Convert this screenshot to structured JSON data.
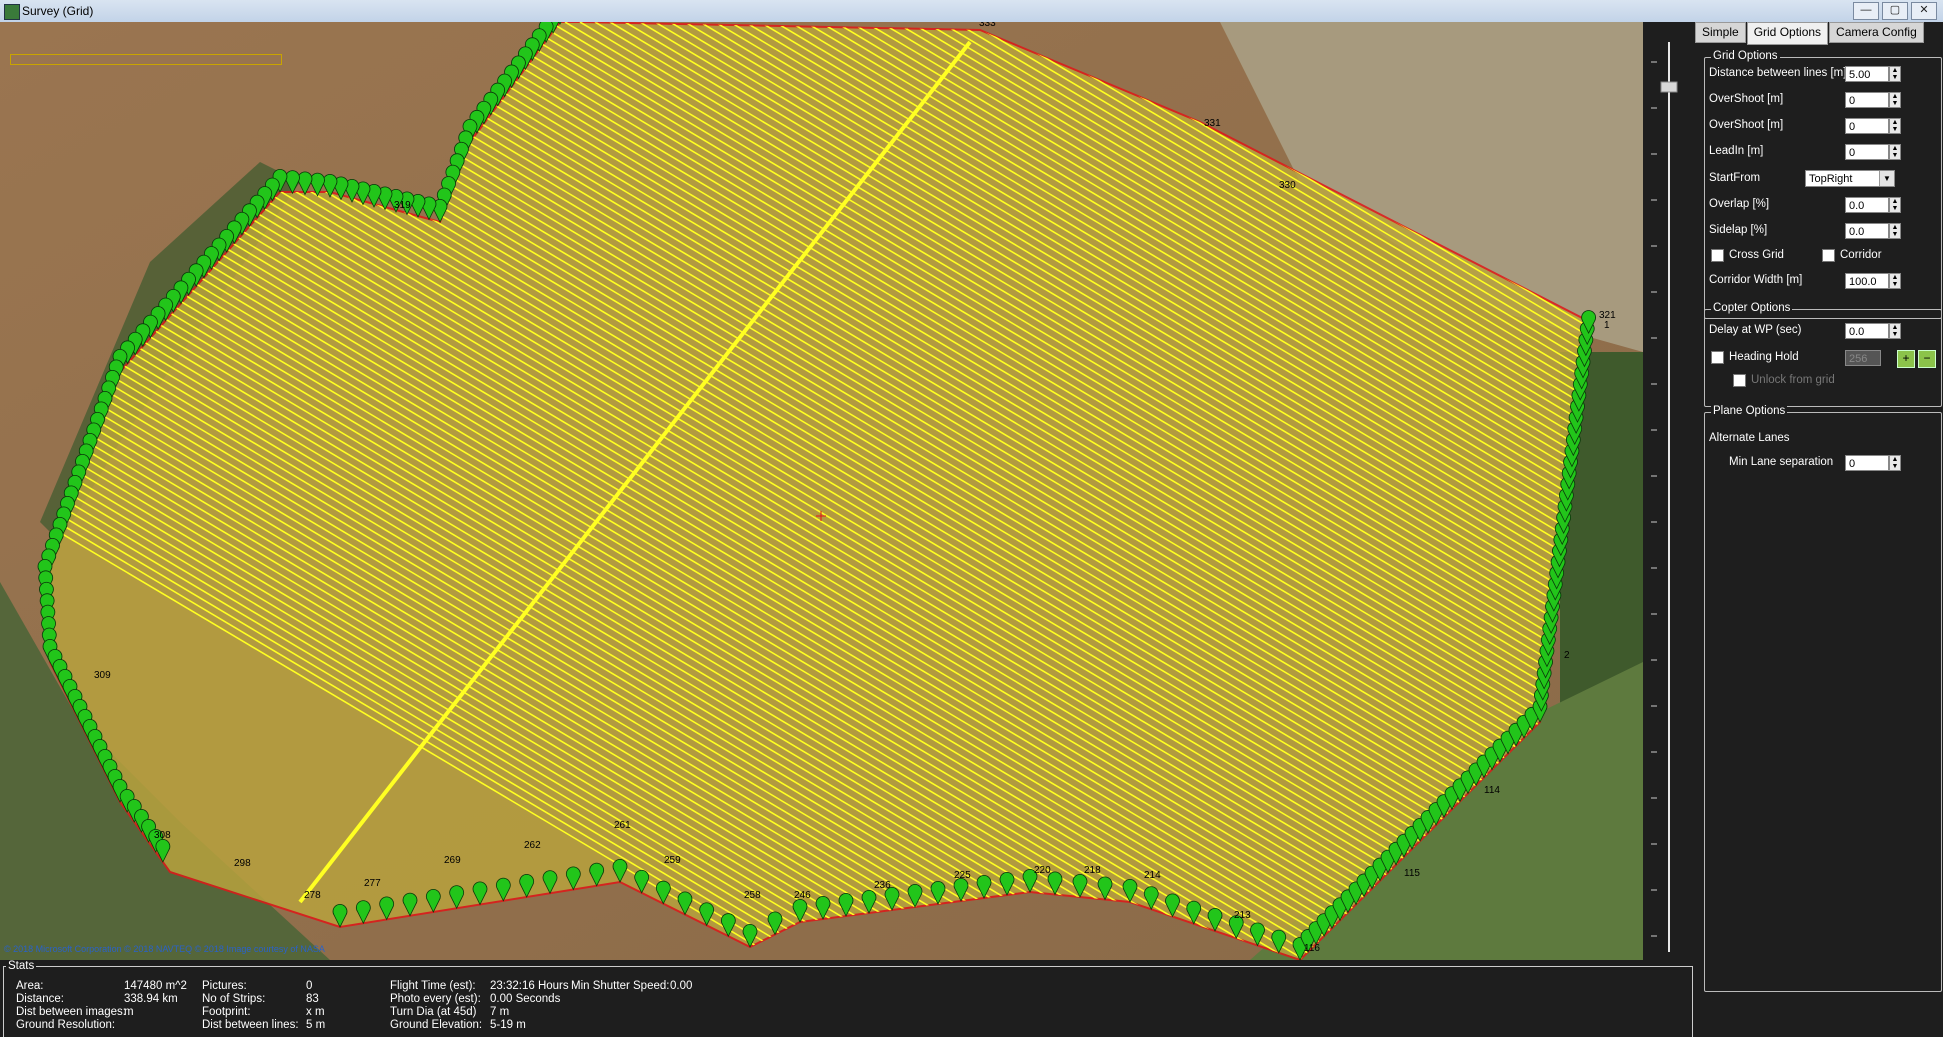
{
  "window": {
    "title": "Survey (Grid)",
    "min": "—",
    "max": "▢",
    "close": "✕"
  },
  "map": {
    "attribution": "© 2018 Microsoft Corporation  © 2018 NAVTEQ  © 2018 Image courtesy of NASA"
  },
  "colors": {
    "grid_line": "#ffff22",
    "boundary": "#e01818",
    "marker_green": "#22c51a",
    "marker_red": "#e85050"
  },
  "markers": {
    "labels": [
      "333",
      "331",
      "330",
      "321",
      "319",
      "309",
      "308",
      "298",
      "278",
      "277",
      "269",
      "262",
      "261",
      "259",
      "258",
      "246",
      "236",
      "225",
      "220",
      "218",
      "214",
      "213",
      "116",
      "115",
      "114",
      "2",
      "1"
    ]
  },
  "tabs": [
    "Simple",
    "Grid Options",
    "Camera Config"
  ],
  "grid_options": {
    "title": "Grid Options",
    "distance_label": "Distance between lines [m]",
    "distance_value": "5.00",
    "overshoot1_label": "OverShoot [m]",
    "overshoot1_value": "0",
    "overshoot2_label": "OverShoot [m]",
    "overshoot2_value": "0",
    "leadin_label": "LeadIn [m]",
    "leadin_value": "0",
    "startfrom_label": "StartFrom",
    "startfrom_value": "TopRight",
    "overlap_label": "Overlap [%]",
    "overlap_value": "0.0",
    "sidelap_label": "Sidelap [%]",
    "sidelap_value": "0.0",
    "crossgrid_label": "Cross Grid",
    "corridor_label": "Corridor",
    "corridor_width_label": "Corridor Width [m]",
    "corridor_width_value": "100.0"
  },
  "copter_options": {
    "title": "Copter Options",
    "delay_label": "Delay at WP (sec)",
    "delay_value": "0.0",
    "heading_hold_label": "Heading Hold",
    "heading_value": "256",
    "plus": "+",
    "minus": "−",
    "unlock_label": "Unlock from grid"
  },
  "plane_options": {
    "title": "Plane Options",
    "alternate_label": "Alternate Lanes",
    "min_lane_label": "Min Lane separation",
    "min_lane_value": "0"
  },
  "stats": {
    "title": "Stats",
    "area_label": "Area:",
    "area_value": "147480 m^2",
    "distance_label": "Distance:",
    "distance_value": "338.94 km",
    "dist_images_label": "Dist between images:",
    "dist_images_value": "m",
    "ground_res_label": "Ground Resolution:",
    "ground_res_value": "",
    "pictures_label": "Pictures:",
    "pictures_value": "0",
    "strips_label": "No of Strips:",
    "strips_value": "83",
    "footprint_label": "Footprint:",
    "footprint_value": "x m",
    "dist_lines_label": "Dist between lines:",
    "dist_lines_value": "5 m",
    "flight_time_label": "Flight Time (est):",
    "flight_time_value": "23:32:16 Hours",
    "min_shutter_label": "Min Shutter Speed:",
    "min_shutter_value": "0.00",
    "photo_every_label": "Photo every (est):",
    "photo_every_value": "0.00 Seconds",
    "turn_dia_label": "Turn Dia (at 45d)",
    "turn_dia_value": "7 m",
    "ground_elev_label": "Ground Elevation:",
    "ground_elev_value": "5-19 m"
  }
}
